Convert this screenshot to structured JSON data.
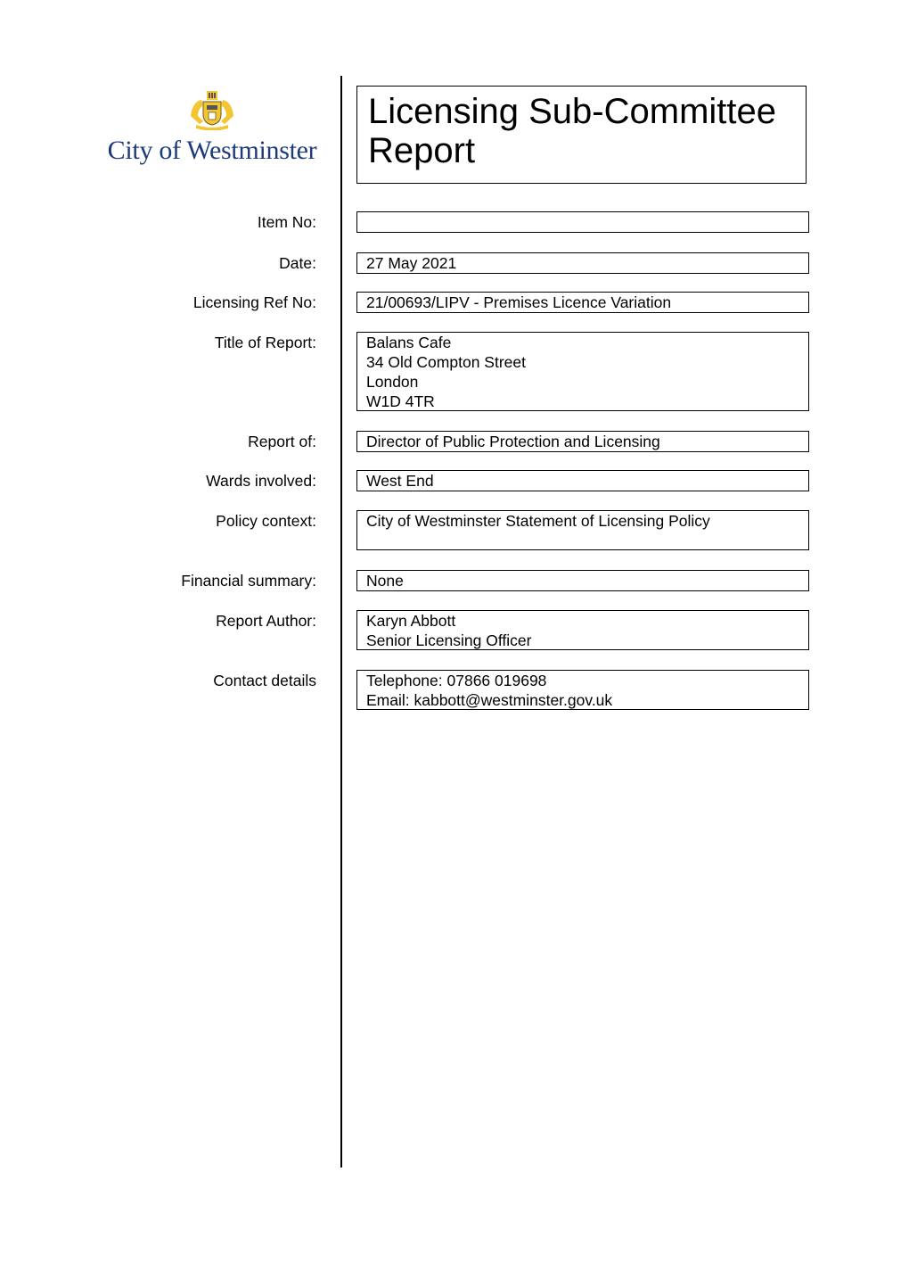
{
  "logo": {
    "crest_icon": "city-of-westminster-crest",
    "text": "City of Westminster",
    "colors": {
      "text": "#1f3a7a",
      "crest": "#f2c531"
    }
  },
  "title": {
    "line1": "Licensing Sub-Committee",
    "line2": "Report"
  },
  "fields": {
    "item_no": {
      "label": "Item No:",
      "lines": []
    },
    "date": {
      "label": "Date:",
      "lines": [
        "27 May 2021"
      ]
    },
    "licensing_ref": {
      "label": "Licensing Ref No:",
      "lines": [
        "21/00693/LIPV - Premises Licence Variation"
      ]
    },
    "title_of_report": {
      "label": "Title of Report:",
      "lines": [
        "Balans Cafe",
        "34 Old Compton Street",
        "London",
        "W1D 4TR"
      ]
    },
    "report_of": {
      "label": "Report of:",
      "lines": [
        "Director of Public Protection and Licensing"
      ]
    },
    "wards": {
      "label": "Wards involved:",
      "lines": [
        "West End"
      ]
    },
    "policy_context": {
      "label": "Policy context:",
      "lines": [
        "City of Westminster Statement of Licensing Policy"
      ]
    },
    "financial_summary": {
      "label": "Financial summary:",
      "lines": [
        "None"
      ]
    },
    "report_author": {
      "label": "Report Author:",
      "lines": [
        "Karyn Abbott",
        "Senior Licensing Officer"
      ]
    },
    "contact_details": {
      "label": "Contact details",
      "lines": [
        "Telephone: 07866 019698",
        "Email: kabbott@westminster.gov.uk"
      ]
    }
  }
}
